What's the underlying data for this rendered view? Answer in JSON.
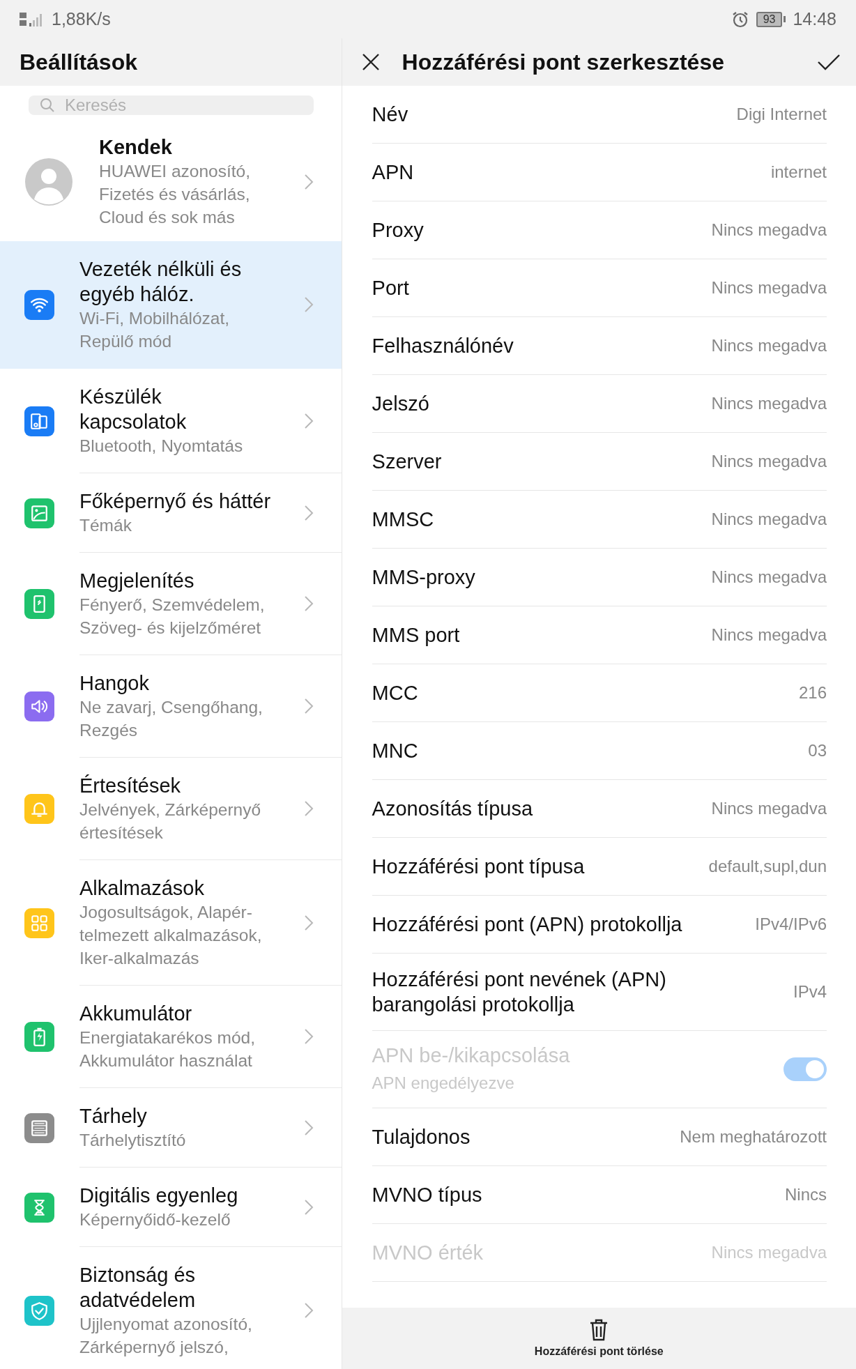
{
  "status_bar": {
    "speed": "1,88K/s",
    "battery": "93",
    "time": "14:48"
  },
  "settings": {
    "title": "Beállítások",
    "search": {
      "placeholder": "Keresés"
    },
    "profile": {
      "name": "Kendek",
      "details": [
        "HUAWEI azonosító,",
        "Fizetés és vásárlás,",
        "Cloud és sok más"
      ]
    },
    "items": [
      {
        "kind": "wifi",
        "color": "#1a7cf5",
        "selected": true,
        "title": [
          "Vezeték nélküli és",
          "egyéb hálóz."
        ],
        "subtitle": [
          "Wi-Fi, Mobilhálózat,",
          "Repülő mód"
        ]
      },
      {
        "kind": "devices",
        "color": "#1a7cf5",
        "selected": false,
        "title": [
          "Készülék",
          "kapcsolatok"
        ],
        "subtitle": [
          "Bluetooth, Nyomtatás"
        ]
      },
      {
        "kind": "wallpaper",
        "color": "#1fc26d",
        "selected": false,
        "title": [
          "Főképernyő és háttér"
        ],
        "subtitle": [
          "Témák"
        ]
      },
      {
        "kind": "display",
        "color": "#1fc26d",
        "selected": false,
        "title": [
          "Megjelenítés"
        ],
        "subtitle": [
          "Fényerő, Szemvédelem,",
          "Szöveg- és kijelzőméret"
        ]
      },
      {
        "kind": "sound",
        "color": "#8b6cf0",
        "selected": false,
        "title": [
          "Hangok"
        ],
        "subtitle": [
          "Ne zavarj, Csengőhang,",
          "Rezgés"
        ]
      },
      {
        "kind": "bell",
        "color": "#ffc51a",
        "selected": false,
        "title": [
          "Értesítések"
        ],
        "subtitle": [
          "Jelvények, Zárképernyő",
          "értesítések"
        ]
      },
      {
        "kind": "apps",
        "color": "#ffc51a",
        "selected": false,
        "title": [
          "Alkalmazások"
        ],
        "subtitle": [
          "Jogosultságok, Alapér-",
          "telmezett alkalmazások,",
          "Iker-alkalmazás"
        ]
      },
      {
        "kind": "battery",
        "color": "#1fc26d",
        "selected": false,
        "title": [
          "Akkumulátor"
        ],
        "subtitle": [
          "Energiatakarékos mód,",
          "Akkumulátor használat"
        ]
      },
      {
        "kind": "storage",
        "color": "#8c8c8c",
        "selected": false,
        "title": [
          "Tárhely"
        ],
        "subtitle": [
          "Tárhelytisztító"
        ]
      },
      {
        "kind": "hourglass",
        "color": "#1fc26d",
        "selected": false,
        "title": [
          "Digitális egyenleg"
        ],
        "subtitle": [
          "Képernyőidő-kezelő"
        ]
      },
      {
        "kind": "shield",
        "color": "#1ec3c9",
        "selected": false,
        "title": [
          "Biztonság és",
          "adatvédelem"
        ],
        "subtitle": [
          "Ujjlenyomat azonosító,",
          "Zárképernyő jelszó,"
        ]
      }
    ]
  },
  "editor": {
    "title": "Hozzáférési pont szerkesztése",
    "fields": [
      {
        "kind": "value",
        "label": [
          "Név"
        ],
        "value": "Digi Internet",
        "disabled": false
      },
      {
        "kind": "value",
        "label": [
          "APN"
        ],
        "value": "internet",
        "disabled": false
      },
      {
        "kind": "value",
        "label": [
          "Proxy"
        ],
        "value": "Nincs megadva",
        "disabled": false
      },
      {
        "kind": "value",
        "label": [
          "Port"
        ],
        "value": "Nincs megadva",
        "disabled": false
      },
      {
        "kind": "value",
        "label": [
          "Felhasználónév"
        ],
        "value": "Nincs megadva",
        "disabled": false
      },
      {
        "kind": "value",
        "label": [
          "Jelszó"
        ],
        "value": "Nincs megadva",
        "disabled": false
      },
      {
        "kind": "value",
        "label": [
          "Szerver"
        ],
        "value": "Nincs megadva",
        "disabled": false
      },
      {
        "kind": "value",
        "label": [
          "MMSC"
        ],
        "value": "Nincs megadva",
        "disabled": false
      },
      {
        "kind": "value",
        "label": [
          "MMS-proxy"
        ],
        "value": "Nincs megadva",
        "disabled": false
      },
      {
        "kind": "value",
        "label": [
          "MMS port"
        ],
        "value": "Nincs megadva",
        "disabled": false
      },
      {
        "kind": "value",
        "label": [
          "MCC"
        ],
        "value": "216",
        "disabled": false
      },
      {
        "kind": "value",
        "label": [
          "MNC"
        ],
        "value": "03",
        "disabled": false
      },
      {
        "kind": "value",
        "label": [
          "Azonosítás típusa"
        ],
        "value": "Nincs megadva",
        "disabled": false
      },
      {
        "kind": "value",
        "label": [
          "Hozzáférési pont típusa"
        ],
        "value": "default,supl,dun",
        "disabled": false
      },
      {
        "kind": "value",
        "label": [
          "Hozzáférési pont (APN) protokollja"
        ],
        "value": "IPv4/IPv6",
        "disabled": false
      },
      {
        "kind": "value",
        "label": [
          "Hozzáférési pont nevének (APN)",
          "barangolási protokollja"
        ],
        "value": "IPv4",
        "disabled": false
      },
      {
        "kind": "toggle",
        "label": [
          "APN be-/kikapcsolása"
        ],
        "subtitle": "APN engedélyezve",
        "on": true,
        "disabled": true
      },
      {
        "kind": "value",
        "label": [
          "Tulajdonos"
        ],
        "value": "Nem meghatározott",
        "disabled": false
      },
      {
        "kind": "value",
        "label": [
          "MVNO típus"
        ],
        "value": "Nincs",
        "disabled": false
      },
      {
        "kind": "value",
        "label": [
          "MVNO érték"
        ],
        "value": "Nincs megadva",
        "disabled": true
      }
    ],
    "delete_action": "Hozzáférési pont törlése"
  }
}
